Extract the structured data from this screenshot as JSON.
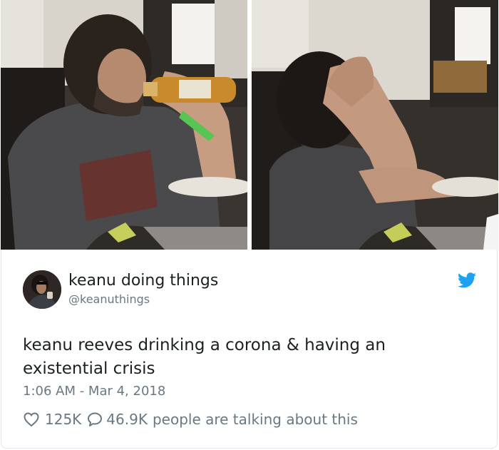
{
  "tweet": {
    "display_name": "keanu doing things",
    "handle": "@keanuthings",
    "text": "keanu reeves drinking a corona & having an existential crisis",
    "timestamp": "1:06 AM - Mar 4, 2018",
    "likes": "125K",
    "replies": "46.9K",
    "replies_suffix": "people are talking about this"
  },
  "icons": {
    "brand": "twitter-bird-icon",
    "like": "heart-icon",
    "reply": "speech-bubble-icon"
  },
  "colors": {
    "brand_blue": "#1da1f2",
    "text_primary": "#1c2022",
    "text_secondary": "#697882",
    "border": "#e1e8ed"
  }
}
